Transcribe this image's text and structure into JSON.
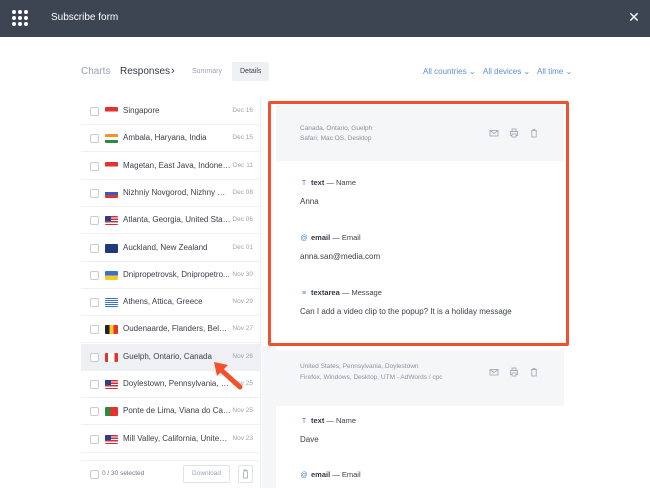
{
  "app": {
    "title": "Subscribe form",
    "close_icon": "close-icon"
  },
  "nav": {
    "charts": "Charts",
    "responses": "Responses",
    "chevron": "›",
    "summary": "Summary",
    "details": "Details",
    "filters": [
      "All countries",
      "All devices",
      "All time"
    ]
  },
  "list": {
    "rows": [
      {
        "location": "Singapore",
        "date": "Dec 16",
        "flag": "sg"
      },
      {
        "location": "Ambala, Haryana, India",
        "date": "Dec 15",
        "flag": "in"
      },
      {
        "location": "Magetan, East Java, Indonesia",
        "date": "Dec 11",
        "flag": "id"
      },
      {
        "location": "Nizhniy Novgorod, Nizhny No...",
        "date": "Dec 08",
        "flag": "ru"
      },
      {
        "location": "Atlanta, Georgia, United Stat...",
        "date": "Dec 06",
        "flag": "us"
      },
      {
        "location": "Auckland, New Zealand",
        "date": "Dec 01",
        "flag": "nz"
      },
      {
        "location": "Dnipropetrovsk, Dnipropetro...",
        "date": "Nov 30",
        "flag": "ua"
      },
      {
        "location": "Athens, Attica, Greece",
        "date": "Nov 29",
        "flag": "gr"
      },
      {
        "location": "Oudenaarde, Flanders, Belgi...",
        "date": "Nov 27",
        "flag": "be"
      },
      {
        "location": "Guelph, Ontario, Canada",
        "date": "Nov 26",
        "flag": "ca"
      },
      {
        "location": "Doylestown, Pennsylvania, U...",
        "date": "Nov 25",
        "flag": "us"
      },
      {
        "location": "Ponte de Lima, Viana do Cast...",
        "date": "Nov 25",
        "flag": "pt"
      },
      {
        "location": "Mill Valley, California, United ...",
        "date": "Nov 23",
        "flag": "us"
      }
    ],
    "selected_index": 9,
    "footer": {
      "selected": "0 / 30 selected",
      "download": "Download"
    }
  },
  "responses": [
    {
      "meta_location": "Canada, Ontario, Guelph",
      "meta_device": "Safari, Mac OS, Desktop",
      "fields": [
        {
          "icon": "T",
          "type": "text",
          "label": " — Name",
          "value": "Anna"
        },
        {
          "icon": "@",
          "type": "email",
          "label": " — Email",
          "value": "anna.san@media.com"
        },
        {
          "icon": "≡",
          "type": "textarea",
          "label": " — Message",
          "value": "Can I add a video clip to the popup? It is a holiday message"
        }
      ]
    },
    {
      "meta_location": "United States, Pennsylvania, Doylestown",
      "meta_device": "Firefox, Windows, Desktop, UTM - AdWords / cpc",
      "fields": [
        {
          "icon": "T",
          "type": "text",
          "label": " — Name",
          "value": "Dave"
        },
        {
          "icon": "@",
          "type": "email",
          "label": " — Email",
          "value": ""
        }
      ]
    }
  ],
  "colors": {
    "topbar": "#3d4452",
    "accent": "#5b8fd6",
    "highlight": "#f0522d"
  }
}
